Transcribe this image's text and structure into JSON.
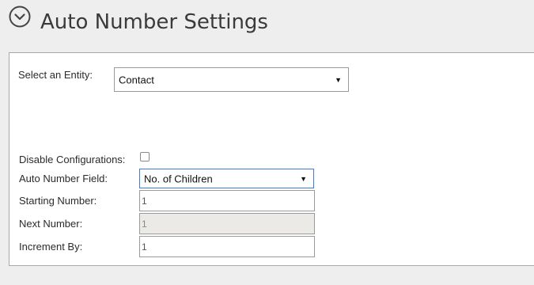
{
  "header": {
    "title": "Auto Number Settings",
    "collapse_icon": "chevron-circle-down-icon"
  },
  "entity": {
    "label": "Select an Entity:",
    "selected": "Contact"
  },
  "config": {
    "disable_label": "Disable Configurations:",
    "disable_checked": false,
    "field_label": "Auto Number Field:",
    "field_selected": "No. of Children",
    "starting_label": "Starting Number:",
    "starting_value": "1",
    "next_label": "Next Number:",
    "next_value": "1",
    "increment_label": "Increment By:",
    "increment_value": "1"
  },
  "colors": {
    "background": "#eeeeee",
    "panel": "#ffffff",
    "focus_border": "#3b7dd8",
    "disabled_field": "#ebeae6"
  }
}
